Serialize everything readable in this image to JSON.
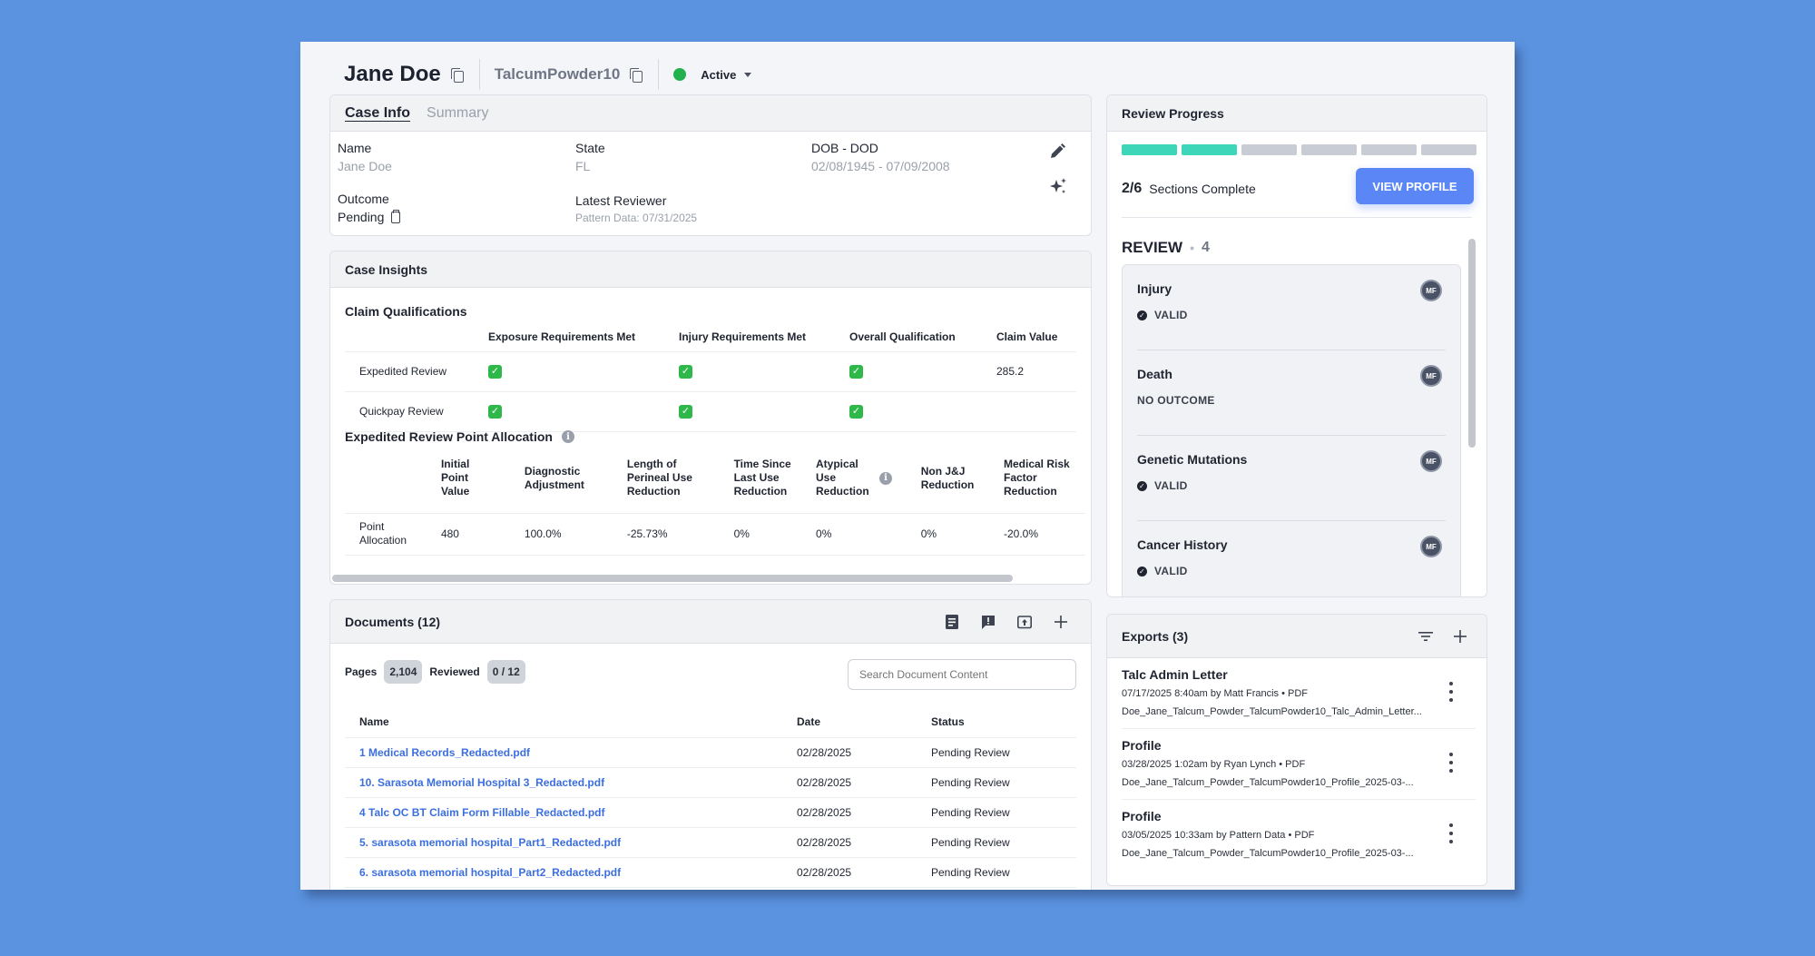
{
  "header": {
    "name": "Jane Doe",
    "case_id": "TalcumPowder10",
    "status": "Active",
    "status_color": "#22b14c"
  },
  "case_info": {
    "tabs": [
      {
        "label": "Case Info",
        "active": true
      },
      {
        "label": "Summary",
        "active": false
      }
    ],
    "fields": {
      "name_label": "Name",
      "name_value": "Jane Doe",
      "state_label": "State",
      "state_value": "FL",
      "dob_label": "DOB - DOD",
      "dob_value": "02/08/1945 - 07/09/2008",
      "outcome_label": "Outcome",
      "outcome_value": "Pending",
      "reviewer_label": "Latest Reviewer",
      "reviewer_value": "Pattern Data: 07/31/2025"
    },
    "icons": [
      "pencil-icon",
      "sparkle-icon",
      "clipboard-icon"
    ]
  },
  "case_insights": {
    "title": "Case Insights",
    "claim_qualifications": {
      "title": "Claim Qualifications",
      "headers": [
        "",
        "Exposure Requirements Met",
        "Injury Requirements Met",
        "Overall Qualification",
        "Claim Value"
      ],
      "rows": [
        {
          "label": "Expedited Review",
          "exposure": true,
          "injury": true,
          "overall": true,
          "value": "285.2"
        },
        {
          "label": "Quickpay Review",
          "exposure": true,
          "injury": true,
          "overall": true,
          "value": ""
        }
      ]
    },
    "point_allocation": {
      "title": "Expedited Review Point Allocation",
      "headers": [
        "",
        "Initial Point Value",
        "Diagnostic Adjustment",
        "Length of Perineal Use Reduction",
        "Time Since Last Use Reduction",
        "Atypical Use Reduction",
        "Non J&J Reduction",
        "Medical Risk Factor Reduction"
      ],
      "row": {
        "label": "Point Allocation",
        "values": [
          "480",
          "100.0%",
          "-25.73%",
          "0%",
          "0%",
          "0%",
          "-20.0%"
        ]
      }
    }
  },
  "documents": {
    "title": "Documents (12)",
    "pages_label": "Pages",
    "pages_value": "2,104",
    "reviewed_label": "Reviewed",
    "reviewed_value": "0 / 12",
    "search_placeholder": "Search Document Content",
    "columns": [
      "Name",
      "Date",
      "Status"
    ],
    "rows": [
      {
        "name": "1 Medical Records_Redacted.pdf",
        "date": "02/28/2025",
        "status": "Pending Review"
      },
      {
        "name": "10. Sarasota Memorial Hospital 3_Redacted.pdf",
        "date": "02/28/2025",
        "status": "Pending Review"
      },
      {
        "name": "4 Talc OC BT Claim Form Fillable_Redacted.pdf",
        "date": "02/28/2025",
        "status": "Pending Review"
      },
      {
        "name": "5. sarasota memorial hospital_Part1_Redacted.pdf",
        "date": "02/28/2025",
        "status": "Pending Review"
      },
      {
        "name": "6. sarasota memorial hospital_Part2_Redacted.pdf",
        "date": "02/28/2025",
        "status": "Pending Review"
      }
    ]
  },
  "review_progress": {
    "title": "Review Progress",
    "sections_done": 2,
    "sections_total": 6,
    "sections_text": "2/6",
    "sections_label": "Sections Complete",
    "view_profile": "VIEW PROFILE",
    "accent": "#3dd6b8",
    "review_title": "REVIEW",
    "review_count": "4",
    "items": [
      {
        "title": "Injury",
        "status": "VALID",
        "valid": true,
        "avatar": "MF"
      },
      {
        "title": "Death",
        "status": "NO OUTCOME",
        "valid": false,
        "avatar": "MF"
      },
      {
        "title": "Genetic Mutations",
        "status": "VALID",
        "valid": true,
        "avatar": "MF"
      },
      {
        "title": "Cancer History",
        "status": "VALID",
        "valid": true,
        "avatar": "MF"
      }
    ]
  },
  "exports": {
    "title": "Exports (3)",
    "items": [
      {
        "title": "Talc Admin Letter",
        "meta": "07/17/2025 8:40am by Matt Francis • PDF",
        "file": "Doe_Jane_Talcum_Powder_TalcumPowder10_Talc_Admin_Letter..."
      },
      {
        "title": "Profile",
        "meta": "03/28/2025 1:02am by Ryan Lynch • PDF",
        "file": "Doe_Jane_Talcum_Powder_TalcumPowder10_Profile_2025-03-..."
      },
      {
        "title": "Profile",
        "meta": "03/05/2025 10:33am by Pattern Data • PDF",
        "file": "Doe_Jane_Talcum_Powder_TalcumPowder10_Profile_2025-03-..."
      }
    ]
  }
}
